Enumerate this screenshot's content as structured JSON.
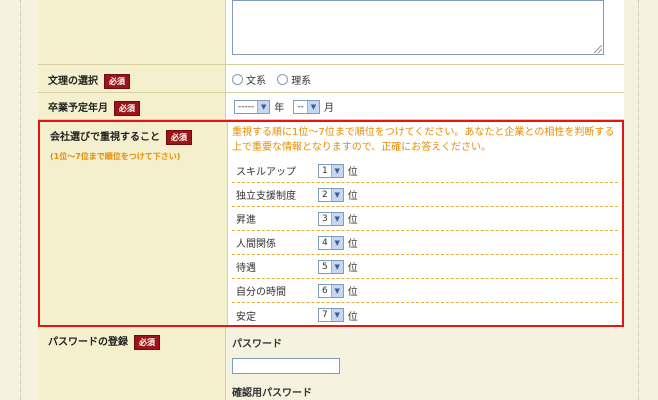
{
  "required_label": "必須",
  "humanities": {
    "label": "文理の選択",
    "options": [
      "文系",
      "理系"
    ]
  },
  "graduation": {
    "label": "卒業予定年月",
    "year_value": "-----",
    "year_unit": "年",
    "month_value": "--",
    "month_unit": "月"
  },
  "priorities": {
    "label": "会社選びで重視すること",
    "sub_label": "(1位〜7位まで順位をつけて下さい)",
    "intro": "重視する順に1位〜7位まで順位をつけてください。あなたと企業との相性を判断する上で重要な情報となりますので、正確にお答えください。",
    "rank_unit": "位",
    "items": [
      {
        "name": "スキルアップ",
        "rank": "1"
      },
      {
        "name": "独立支援制度",
        "rank": "2"
      },
      {
        "name": "昇進",
        "rank": "3"
      },
      {
        "name": "人間関係",
        "rank": "4"
      },
      {
        "name": "待遇",
        "rank": "5"
      },
      {
        "name": "自分の時間",
        "rank": "6"
      },
      {
        "name": "安定",
        "rank": "7"
      }
    ]
  },
  "password": {
    "label": "パスワードの登録",
    "password_label": "パスワード",
    "confirm_label": "確認用パスワード"
  },
  "colors": {
    "required_badge": "#9c1318",
    "highlight_border": "#e5150f",
    "instruction_text": "#e98b00"
  }
}
